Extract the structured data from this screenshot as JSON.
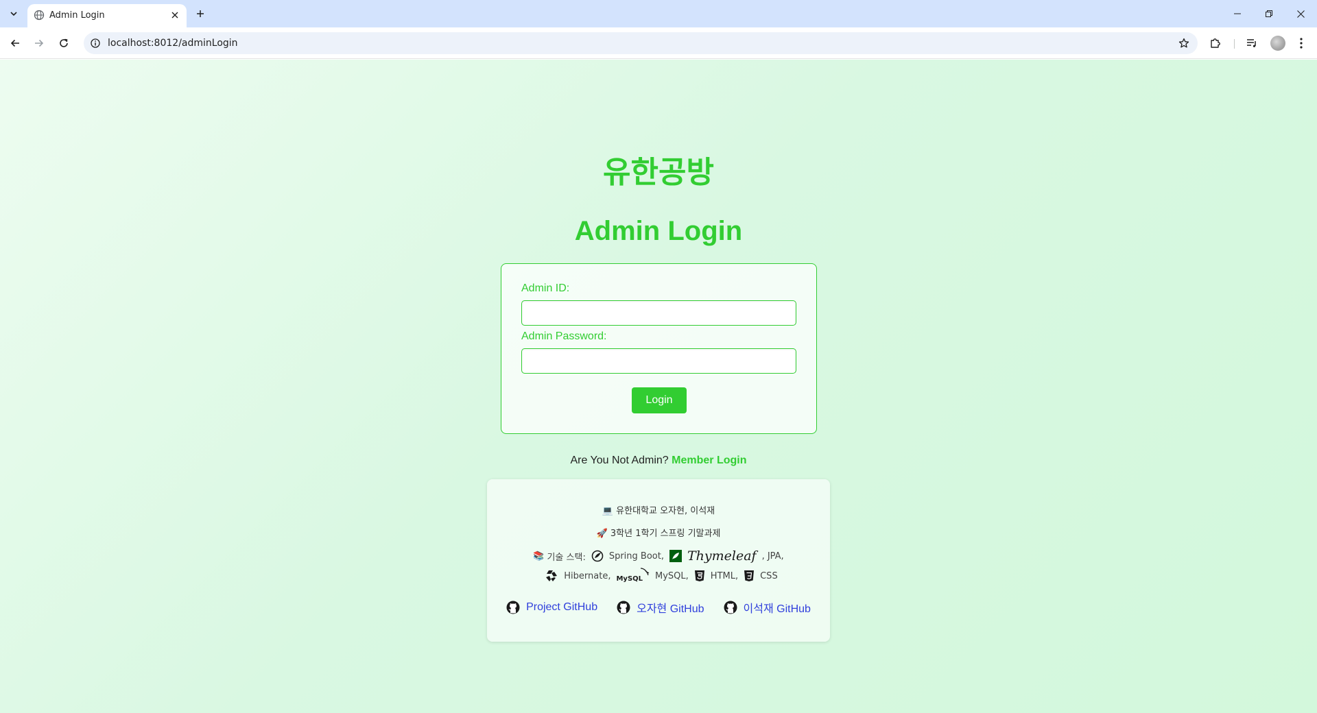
{
  "browser": {
    "tab_title": "Admin Login",
    "url": "localhost:8012/adminLogin"
  },
  "page": {
    "brand": "유한공방",
    "title": "Admin Login",
    "form": {
      "id_label": "Admin ID:",
      "id_value": "",
      "password_label": "Admin Password:",
      "password_value": "",
      "login_button": "Login"
    },
    "not_admin_text": "Are You Not Admin?",
    "member_login_link": "Member Login",
    "accent_color": "#32cd32"
  },
  "footer": {
    "authors_emoji": "💻",
    "authors": "유한대학교 오자현, 이석재",
    "project_emoji": "🚀",
    "project": "3학년 1학기 스프링 기말과제",
    "stack_emoji": "📚",
    "stack_label": "기술 스택:",
    "spring_boot": "Spring Boot,",
    "thymeleaf": "Thymeleaf",
    "jpa": ", JPA,",
    "hibernate": "Hibernate,",
    "mysql_logo": "MySQL",
    "mysql": "MySQL,",
    "html": "HTML,",
    "css": "CSS",
    "links": [
      "Project GitHub",
      "오자현 GitHub",
      "이석재 GitHub"
    ],
    "link_color": "#2f3fdc"
  }
}
